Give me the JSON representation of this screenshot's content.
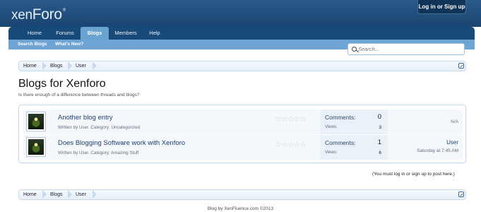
{
  "header": {
    "logo_main": "xen",
    "logo_accent": "Foro",
    "logo_tm": "®",
    "login_label": "Log in or Sign up"
  },
  "nav": {
    "tabs": [
      "Home",
      "Forums",
      "Blogs",
      "Members",
      "Help"
    ],
    "active_tab": "Blogs",
    "sublinks": [
      "Search Blogs",
      "What's New?"
    ]
  },
  "search": {
    "placeholder": "Search..."
  },
  "breadcrumb": {
    "items": [
      "Home",
      "Blogs",
      "User"
    ]
  },
  "page": {
    "title": "Blogs for Xenforo",
    "description": "Is there enough of a difference between threads and blogs?"
  },
  "entries": [
    {
      "title": "Another blog entry",
      "meta": "Written by User. Category: Uncategorized",
      "stars": "☆☆☆☆☆",
      "rating": 0,
      "comments_label": "Comments:",
      "comments": "0",
      "views_label": "Views:",
      "views": "3",
      "last_user": "",
      "last_time": "N/A"
    },
    {
      "title": "Does Blogging Software work with Xenforo",
      "meta": "Written by User. Category: Amazing Stuff",
      "stars": "☆☆☆☆☆",
      "rating": 0,
      "comments_label": "Comments:",
      "comments": "1",
      "views_label": "Views:",
      "views": "6",
      "last_user": "User",
      "last_time": "Saturday at 7:45 AM"
    }
  ],
  "login_note": "(You must log in or sign up to post here.)",
  "footer": {
    "text": "Blog by XenFluence.com ©2013"
  },
  "colors": {
    "header": "#1a4472",
    "nav": "#184a79",
    "active_tab": "#6aa2d0",
    "subnav": "#6ea4d3",
    "link": "#1c3f70"
  }
}
